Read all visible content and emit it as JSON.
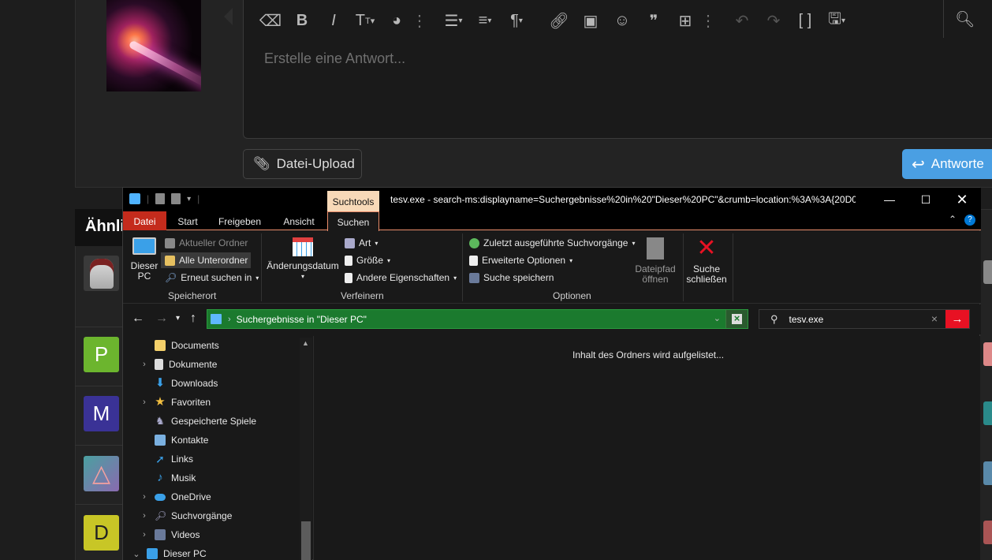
{
  "editor": {
    "placeholder": "Erstelle eine Antwort...",
    "toolbar_icons": [
      "eraser-icon",
      "bold-icon",
      "italic-icon",
      "text-size-icon",
      "palette-icon",
      "more-icon",
      "list-icon",
      "align-icon",
      "paragraph-icon",
      "link-icon",
      "image-icon",
      "smile-icon",
      "quote-icon",
      "table-icon",
      "more-icon",
      "undo-icon",
      "redo-icon",
      "brackets-icon",
      "save-draft-icon",
      "preview-icon"
    ],
    "upload_label": "Datei-Upload",
    "reply_label": "Antworte"
  },
  "similar": {
    "heading": "Ähnli",
    "avatars": [
      "P",
      "M",
      "D"
    ],
    "colors": {
      "p": "#6cb52e",
      "m": "#3a3296",
      "d": "#c8c626"
    }
  },
  "explorer": {
    "window_title": "tesv.exe - search-ms:displayname=Suchergebnisse%20in%20\"Dieser%20PC\"&crumb=location:%3A%3A{20D0",
    "context_tab": "Suchtools",
    "tabs": [
      "Datei",
      "Start",
      "Freigeben",
      "Ansicht",
      "Suchen"
    ],
    "ribbon": {
      "speicherort": {
        "label": "Speicherort",
        "big_button": "Dieser\nPC",
        "items": [
          "Aktueller Ordner",
          "Alle Unterordner",
          "Erneut suchen in"
        ]
      },
      "verfeinern": {
        "label": "Verfeinern",
        "big_button": "Änderungsdatum",
        "items": [
          "Art",
          "Größe",
          "Andere Eigenschaften"
        ]
      },
      "optionen": {
        "label": "Optionen",
        "items": [
          "Zuletzt ausgeführte Suchvorgänge",
          "Erweiterte Optionen",
          "Suche speichern"
        ],
        "open_path": "Dateipfad\nöffnen",
        "close_search": "Suche\nschließen"
      }
    },
    "address": {
      "crumb": "Suchergebnisse in \"Dieser PC\""
    },
    "search": {
      "value": "tesv.exe"
    },
    "nav_items": [
      {
        "label": "Documents",
        "expandable": false
      },
      {
        "label": "Dokumente",
        "expandable": true
      },
      {
        "label": "Downloads",
        "expandable": false
      },
      {
        "label": "Favoriten",
        "expandable": true
      },
      {
        "label": "Gespeicherte Spiele",
        "expandable": false
      },
      {
        "label": "Kontakte",
        "expandable": false
      },
      {
        "label": "Links",
        "expandable": false
      },
      {
        "label": "Musik",
        "expandable": false
      },
      {
        "label": "OneDrive",
        "expandable": true
      },
      {
        "label": "Suchvorgänge",
        "expandable": true
      },
      {
        "label": "Videos",
        "expandable": true
      },
      {
        "label": "Dieser PC",
        "expandable": true
      }
    ],
    "content_message": "Inhalt des Ordners wird aufgelistet..."
  }
}
